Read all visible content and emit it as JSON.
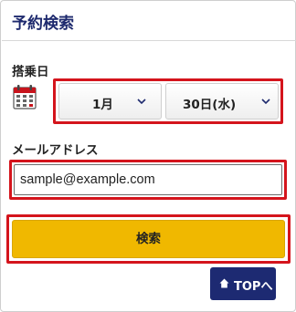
{
  "header": {
    "title": "予約検索"
  },
  "boarding_date": {
    "label": "搭乗日",
    "month": {
      "value": "1月"
    },
    "day": {
      "value": "30日(水)"
    }
  },
  "email": {
    "label": "メールアドレス",
    "value": "sample@example.com"
  },
  "search_button": {
    "label": "検索"
  },
  "top_button": {
    "label": "TOPへ"
  },
  "colors": {
    "title": "#1e2a6e",
    "highlight": "#d4141c",
    "search_button": "#f0b800",
    "top_button": "#1d2a72"
  }
}
